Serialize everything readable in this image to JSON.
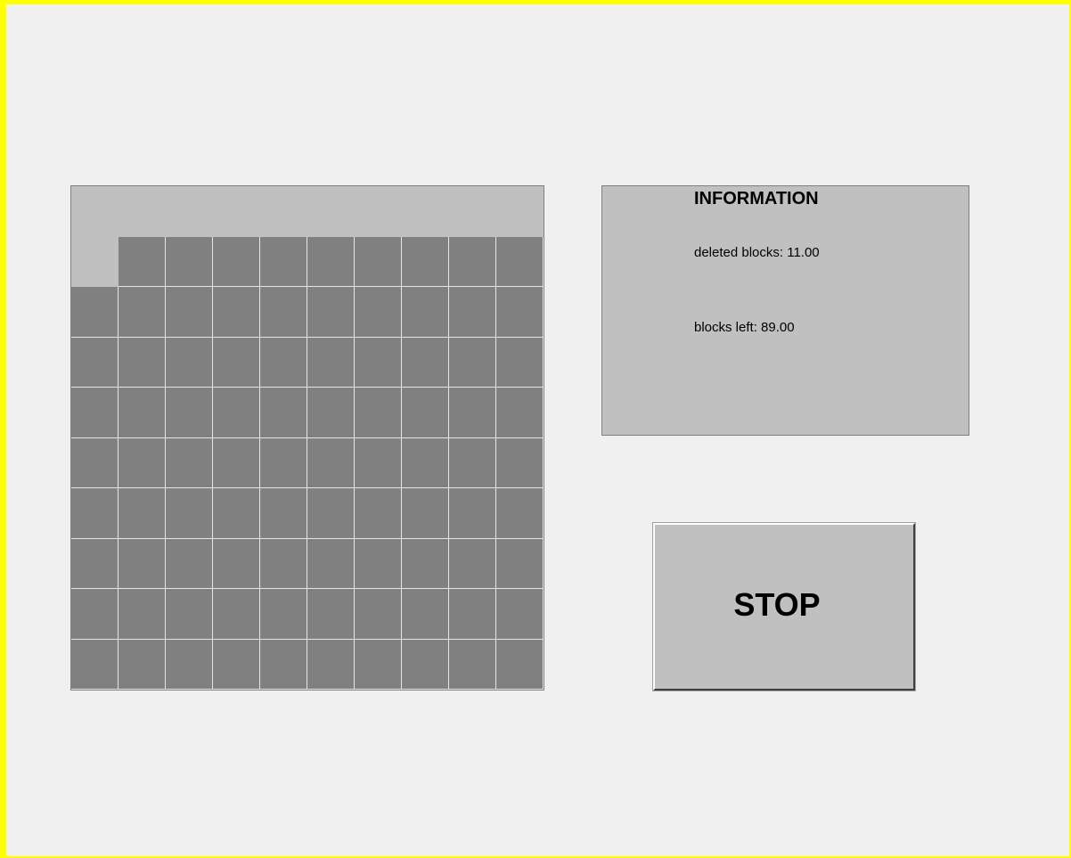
{
  "information": {
    "title": "INFORMATION",
    "deleted_blocks_text": "deleted blocks: 11.00",
    "blocks_left_text": "blocks left: 89.00"
  },
  "stop_button": {
    "label": "STOP"
  },
  "board": {
    "rows": 10,
    "cols": 10,
    "deleted_cells": [
      [
        0,
        0
      ],
      [
        0,
        1
      ],
      [
        0,
        2
      ],
      [
        0,
        3
      ],
      [
        0,
        4
      ],
      [
        0,
        5
      ],
      [
        0,
        6
      ],
      [
        0,
        7
      ],
      [
        0,
        8
      ],
      [
        0,
        9
      ],
      [
        1,
        0
      ]
    ],
    "colors": {
      "block": "#808080",
      "deleted": "#c0c0c0",
      "gridline": "#e6e6e6"
    }
  },
  "colors": {
    "window_border": "#ffff00",
    "background": "#f0f0f0",
    "panel": "#c0c0c0"
  }
}
